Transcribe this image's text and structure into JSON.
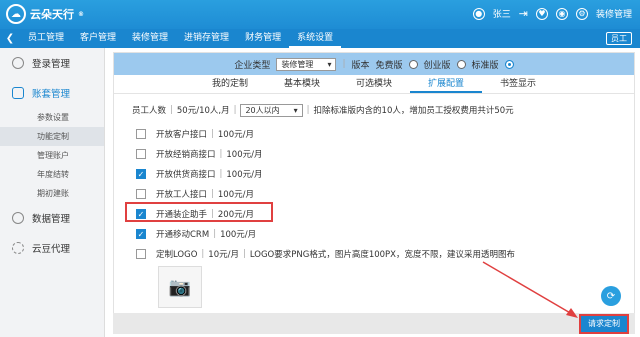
{
  "app": {
    "logo_text": "云朵天行",
    "logo_tm": "®",
    "user_name": "张三",
    "role": "装修管理"
  },
  "nav": {
    "items": [
      "员工管理",
      "客户管理",
      "装修管理",
      "进销存管理",
      "财务管理",
      "系统设置"
    ],
    "active_index": 5,
    "help_label": "员工"
  },
  "sidebar": {
    "sections": [
      {
        "label": "登录管理",
        "icon": "user-icon"
      },
      {
        "label": "账套管理",
        "icon": "account-icon",
        "sub": [
          "参数设置",
          "功能定制",
          "管理账户",
          "年度结转",
          "期初建账"
        ]
      },
      {
        "label": "数据管理",
        "icon": "data-icon"
      },
      {
        "label": "云豆代理",
        "icon": "bean-icon"
      }
    ],
    "selected_sub": "功能定制"
  },
  "header_bar": {
    "company_type_label": "企业类型",
    "company_type_value": "装修管理",
    "version_label": "版本",
    "version_free": "免费版",
    "version_startup": "创业版",
    "version_standard": "标准版",
    "selected_version": "标准版"
  },
  "tabs": {
    "items": [
      "我的定制",
      "基本模块",
      "可选模块",
      "扩展配置",
      "书签显示"
    ],
    "active_index": 3
  },
  "staff_row": {
    "label": "员工人数",
    "price": "50元/10人,月",
    "select_value": "20人以内",
    "note": "扣除标准版内含的10人，增加员工授权费用共计50元"
  },
  "options": [
    {
      "name": "开放客户接口",
      "price": "100元/月",
      "checked": false
    },
    {
      "name": "开放经销商接口",
      "price": "100元/月",
      "checked": false
    },
    {
      "name": "开放供货商接口",
      "price": "100元/月",
      "checked": true
    },
    {
      "name": "开放工人接口",
      "price": "100元/月",
      "checked": false
    },
    {
      "name": "开通装企助手",
      "price": "200元/月",
      "checked": true
    },
    {
      "name": "开通移动CRM",
      "price": "100元/月",
      "checked": true
    },
    {
      "name": "定制LOGO",
      "price": "10元/月",
      "checked": false,
      "note": "LOGO要求PNG格式，图片高度100PX，宽度不限，建议采用透明图布"
    }
  ],
  "footer": {
    "request_button": "请求定制"
  },
  "colors": {
    "brand": "#1a86cf",
    "highlight": "#e04040"
  }
}
